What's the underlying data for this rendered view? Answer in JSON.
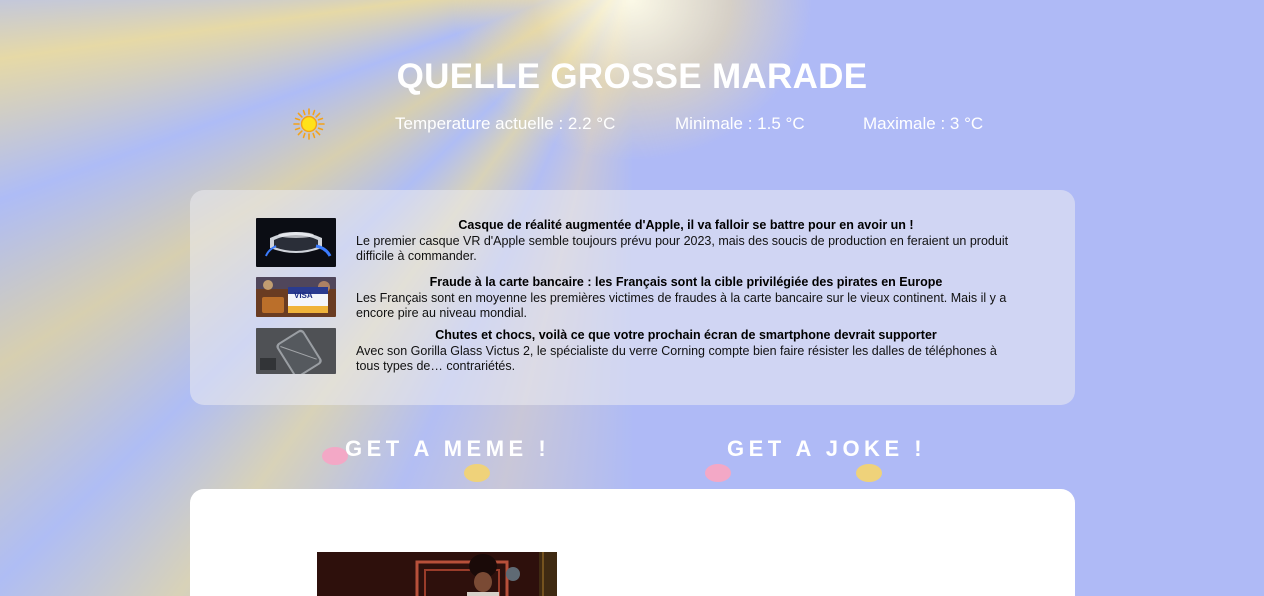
{
  "header": {
    "title": "QUELLE GROSSE MARADE"
  },
  "weather": {
    "icon": "sun-icon",
    "current": "Temperature actuelle : 2.2 °C",
    "min": "Minimale : 1.5 °C",
    "max": "Maximale : 3 °C"
  },
  "news": {
    "items": [
      {
        "title": "Casque de réalité augmentée d'Apple, il va falloir se battre pour en avoir un !",
        "summary": "Le premier casque VR d'Apple semble toujours prévu pour 2023, mais des soucis de production en feraient un produit difficile à commander."
      },
      {
        "title": "Fraude à la carte bancaire : les Français sont la cible privilégiée des pirates en Europe",
        "summary": "Les Français sont en moyenne les premières victimes de fraudes à la carte bancaire sur le vieux continent. Mais il y a encore pire au niveau mondial.",
        "thumb_text": "VISA"
      },
      {
        "title": "Chutes et chocs, voilà ce que votre prochain écran de smartphone devrait supporter",
        "summary": "Avec son Gorilla Glass Victus 2, le spécialiste du verre Corning compte bien faire résister les dalles de téléphones à tous types de… contrariétés."
      }
    ]
  },
  "actions": {
    "meme_label": "GET A MEME !",
    "joke_label": "GET A JOKE !"
  },
  "colors": {
    "title": "#ffffff",
    "dot_pink": "#f3a8c6",
    "dot_yellow": "#efd27a",
    "card": "#ffffff"
  }
}
